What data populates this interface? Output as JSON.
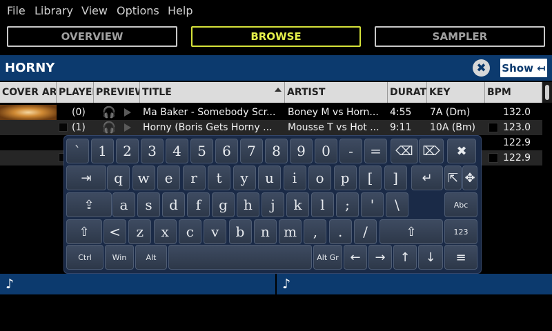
{
  "menu": [
    "File",
    "Library",
    "View",
    "Options",
    "Help"
  ],
  "tabs": [
    "OVERVIEW",
    "BROWSE",
    "SAMPLER"
  ],
  "playlist": {
    "title": "HORNY",
    "clear_icon": "✖",
    "show_label": "Show ↤"
  },
  "columns": [
    "COVER ART",
    "PLAYED",
    "PREVIEW",
    "TITLE",
    "ARTIST",
    "DURATION",
    "KEY",
    "BPM"
  ],
  "tracks": [
    {
      "played": "(0)",
      "title": "Ma Baker - Somebody Scr...",
      "artist": "Boney M vs Horn...",
      "duration": "4:55",
      "key": "7A (Dm)",
      "bpm": "132.0"
    },
    {
      "played": "(1)",
      "title": "Horny (Boris Gets Horny ...",
      "artist": "Mousse T vs Hot ...",
      "duration": "9:11",
      "key": "10A (Bm)",
      "bpm": "123.0"
    },
    {
      "played": "",
      "title": "",
      "artist": "",
      "duration": "",
      "key": "",
      "bpm": "122.9"
    },
    {
      "played": "",
      "title": "",
      "artist": "",
      "duration": "",
      "key": "",
      "bpm": "122.9"
    }
  ],
  "keyboard": {
    "row1": [
      "`",
      "1",
      "2",
      "3",
      "4",
      "5",
      "6",
      "7",
      "8",
      "9",
      "0",
      "-",
      "="
    ],
    "row2": [
      "q",
      "w",
      "e",
      "r",
      "t",
      "y",
      "u",
      "i",
      "o",
      "p",
      "[",
      "]"
    ],
    "row3": [
      "a",
      "s",
      "d",
      "f",
      "g",
      "h",
      "j",
      "k",
      "l",
      ";",
      "'",
      "\\"
    ],
    "row4": [
      "<",
      "z",
      "x",
      "c",
      "v",
      "b",
      "n",
      "m",
      ",",
      ".",
      "/"
    ],
    "backspace": "⌫",
    "delete": "⌦",
    "close": "✖",
    "tab": "⇥",
    "enter": "↵",
    "caps": "⇪",
    "shift_left": "⇧",
    "shift_right": "⇧",
    "cursor": "⇱",
    "move": "✥",
    "abc": "Abc",
    "num": "123",
    "ctrl": "Ctrl",
    "win": "Win",
    "alt": "Alt",
    "altgr": "Alt Gr",
    "left": "←",
    "right": "→",
    "up": "↑",
    "down": "↓",
    "menu": "≡"
  },
  "decks": [
    "♪",
    "♪"
  ]
}
